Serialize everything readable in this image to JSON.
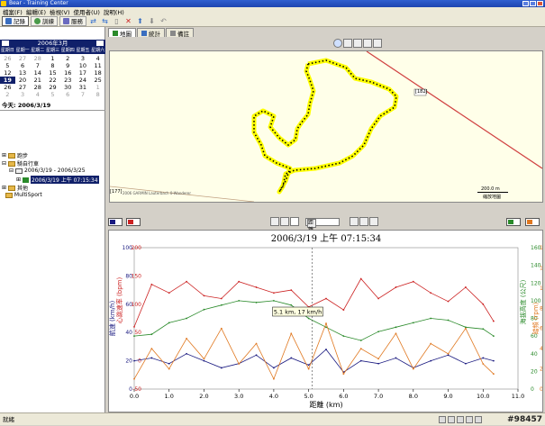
{
  "app": {
    "title": "Bear - Training Center",
    "watermark": "#98457"
  },
  "menu": [
    "檔案(F)",
    "編輯(E)",
    "檢視(V)",
    "使用者(U)",
    "說明(H)"
  ],
  "toolbar": {
    "buttons": [
      {
        "label": "記錄",
        "icon": "journal-icon"
      },
      {
        "label": "訓練",
        "icon": "training-icon"
      },
      {
        "label": "服務",
        "icon": "services-icon"
      }
    ]
  },
  "calendar": {
    "month_title": "2006年3月",
    "dow": [
      "星期日",
      "星期一",
      "星期二",
      "星期三",
      "星期四",
      "星期五",
      "星期六"
    ],
    "days": [
      [
        "26",
        "other"
      ],
      [
        "27",
        "other"
      ],
      [
        "28",
        "other"
      ],
      [
        "1",
        ""
      ],
      [
        "2",
        ""
      ],
      [
        "3",
        ""
      ],
      [
        "4",
        ""
      ],
      [
        "5",
        ""
      ],
      [
        "6",
        ""
      ],
      [
        "7",
        ""
      ],
      [
        "8",
        ""
      ],
      [
        "9",
        ""
      ],
      [
        "10",
        ""
      ],
      [
        "11",
        ""
      ],
      [
        "12",
        ""
      ],
      [
        "13",
        ""
      ],
      [
        "14",
        ""
      ],
      [
        "15",
        ""
      ],
      [
        "16",
        ""
      ],
      [
        "17",
        ""
      ],
      [
        "18",
        ""
      ],
      [
        "19",
        "sel"
      ],
      [
        "20",
        ""
      ],
      [
        "21",
        ""
      ],
      [
        "22",
        ""
      ],
      [
        "23",
        ""
      ],
      [
        "24",
        ""
      ],
      [
        "25",
        ""
      ],
      [
        "26",
        ""
      ],
      [
        "27",
        ""
      ],
      [
        "28",
        ""
      ],
      [
        "29",
        ""
      ],
      [
        "30",
        ""
      ],
      [
        "31",
        ""
      ],
      [
        "1",
        "other"
      ],
      [
        "2",
        "other"
      ],
      [
        "3",
        "other"
      ],
      [
        "4",
        "other"
      ],
      [
        "5",
        "other"
      ],
      [
        "6",
        "other"
      ],
      [
        "7",
        "other"
      ],
      [
        "8",
        "other"
      ]
    ],
    "today_label": "今天: 2006/3/19"
  },
  "tree": {
    "run": "跑步",
    "bike": "騎自行車",
    "week": "2006/3/19 - 2006/3/25",
    "activity": "2006/3/19 上午 07:15:34",
    "other": "其他",
    "multisport": "MultiSport"
  },
  "tabs": [
    {
      "label": "地圖",
      "icon": "map-icon"
    },
    {
      "label": "統計",
      "icon": "stats-icon"
    },
    {
      "label": "備註",
      "icon": "notes-icon"
    }
  ],
  "map": {
    "road_label": "[182]",
    "scale_label": "200.0 m",
    "scale_sub": "縮放地圖",
    "copyright": "2006 GARMIN Lauterbach 0-Wanderer",
    "left_road": "[177]"
  },
  "chart_toolbar": {
    "x_axis_option": "距離"
  },
  "status": {
    "text": "就緒"
  },
  "chart_data": {
    "type": "line",
    "title": "2006/3/19 上午 07:15:34",
    "xlabel": "距離 (km)",
    "xlim": [
      0,
      11
    ],
    "x_ticks": [
      "0.0",
      "1.0",
      "2.0",
      "3.0",
      "4.0",
      "5.0",
      "6.0",
      "7.0",
      "8.0",
      "9.0",
      "10.0",
      "11.0"
    ],
    "axes": [
      {
        "label": "航速 (km/h)",
        "color": "#1a1a80",
        "ylim": [
          0,
          100
        ],
        "ticks": [
          "0",
          "20",
          "40",
          "60",
          "80",
          "100"
        ]
      },
      {
        "label": "心跳速率 (bpm)",
        "color": "#cc2222",
        "ylim": [
          -50,
          200
        ],
        "ticks": [
          "-50",
          "0",
          "50",
          "100",
          "150",
          "200"
        ]
      },
      {
        "label": "海拔高度 (公尺)",
        "color": "#2a8a2a",
        "ylim": [
          0,
          160
        ],
        "ticks": [
          "0",
          "20",
          "40",
          "60",
          "80",
          "100",
          "120",
          "140",
          "160"
        ]
      },
      {
        "label": "踏頻 (rpm)",
        "color": "#e07820",
        "ylim": [
          0,
          140
        ],
        "ticks": [
          "0",
          "20",
          "40",
          "60",
          "80",
          "100",
          "120",
          "140"
        ]
      }
    ],
    "tooltip": "5.1 km, 17 km/h",
    "cursor_x": 5.1,
    "series": [
      {
        "axis": 0,
        "color": "#1a1a80",
        "x": [
          0,
          0.5,
          1,
          1.5,
          2,
          2.5,
          3,
          3.5,
          4,
          4.5,
          5,
          5.5,
          6,
          6.5,
          7,
          7.5,
          8,
          8.5,
          9,
          9.5,
          10,
          10.3
        ],
        "values": [
          20,
          22,
          18,
          25,
          20,
          15,
          18,
          24,
          15,
          22,
          17,
          28,
          12,
          20,
          18,
          22,
          15,
          20,
          24,
          18,
          22,
          20
        ]
      },
      {
        "axis": 1,
        "color": "#cc2222",
        "x": [
          0,
          0.5,
          1,
          1.5,
          2,
          2.5,
          3,
          3.5,
          4,
          4.5,
          5,
          5.5,
          6,
          6.5,
          7,
          7.5,
          8,
          8.5,
          9,
          9.5,
          10,
          10.3
        ],
        "values": [
          60,
          135,
          120,
          140,
          115,
          110,
          140,
          130,
          120,
          125,
          95,
          110,
          90,
          145,
          110,
          130,
          140,
          120,
          105,
          130,
          100,
          70
        ]
      },
      {
        "axis": 2,
        "color": "#2a8a2a",
        "x": [
          0,
          0.5,
          1,
          1.5,
          2,
          2.5,
          3,
          3.5,
          4,
          4.5,
          5,
          5.5,
          6,
          6.5,
          7,
          7.5,
          8,
          8.5,
          9,
          9.5,
          10,
          10.3
        ],
        "values": [
          60,
          62,
          75,
          80,
          90,
          95,
          100,
          98,
          100,
          95,
          80,
          70,
          60,
          55,
          65,
          70,
          75,
          80,
          78,
          70,
          68,
          60
        ]
      },
      {
        "axis": 3,
        "color": "#e07820",
        "x": [
          0,
          0.5,
          1,
          1.5,
          2,
          2.5,
          3,
          3.5,
          4,
          4.5,
          5,
          5.5,
          6,
          6.5,
          7,
          7.5,
          8,
          8.5,
          9,
          9.5,
          10,
          10.3
        ],
        "values": [
          10,
          40,
          20,
          50,
          30,
          60,
          25,
          45,
          10,
          55,
          20,
          65,
          15,
          40,
          30,
          55,
          20,
          45,
          35,
          60,
          25,
          15
        ]
      }
    ]
  }
}
